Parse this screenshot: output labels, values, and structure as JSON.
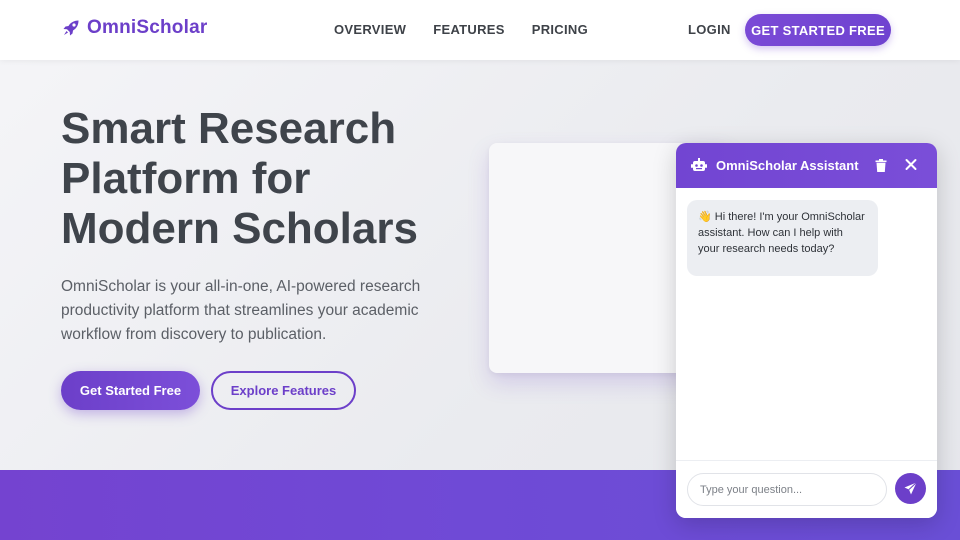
{
  "brand": {
    "name": "OmniScholar",
    "logo_icon": "rocket-icon",
    "accent_color": "#6c3fc9"
  },
  "nav": {
    "items": [
      {
        "label": "OVERVIEW"
      },
      {
        "label": "FEATURES"
      },
      {
        "label": "PRICING"
      }
    ],
    "login_label": "LOGIN",
    "cta_label": "GET STARTED FREE"
  },
  "hero": {
    "title_lines": [
      "Smart Research",
      "Platform for",
      "Modern Scholars"
    ],
    "subtitle": "OmniScholar is your all-in-one, AI-powered research productivity platform that streamlines your academic workflow from discovery to publication.",
    "primary_button": "Get Started Free",
    "secondary_button": "Explore Features"
  },
  "chat": {
    "title": "OmniScholar Assistant",
    "header_icon": "robot-icon",
    "delete_icon": "trash-icon",
    "close_icon": "close-icon",
    "messages": [
      {
        "sender": "bot",
        "text": "👋 Hi there! I'm your OmniScholar assistant. How can I help with your research needs today?"
      }
    ],
    "input_placeholder": "Type your question...",
    "send_icon": "send-icon"
  }
}
